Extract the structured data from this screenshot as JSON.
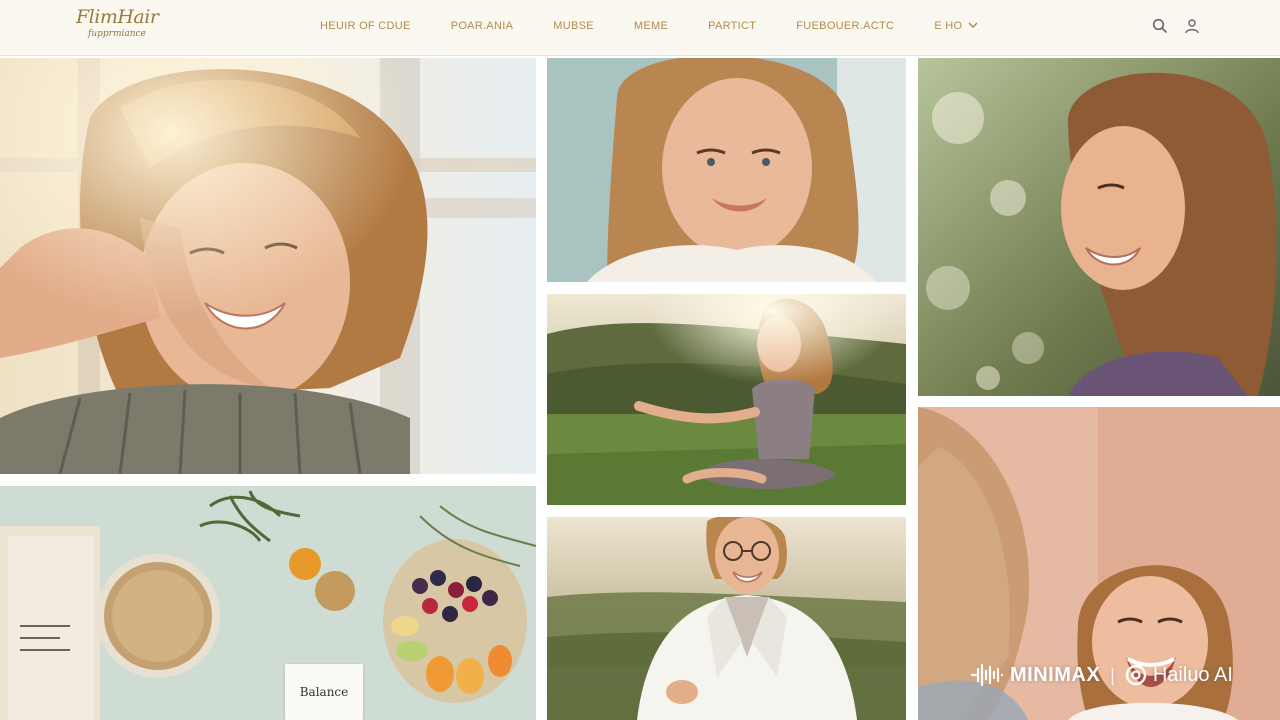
{
  "brand": {
    "logo_main": "FlimHair",
    "logo_sub": "fupprmiance"
  },
  "nav": {
    "items": [
      "HEUIR OF CDUE",
      "POAR.ANIA",
      "MUBSE",
      "MEME",
      "PARTICT",
      "FUEBOUER.ACTC",
      "E HO"
    ]
  },
  "header_icons": [
    "search-icon",
    "user-icon"
  ],
  "gallery": {
    "book_label": "Balance"
  },
  "watermark": {
    "brand_a": "MINIMAX",
    "brand_b": "Hailuo AI"
  },
  "colors": {
    "accent": "#b08c4a",
    "header_bg": "#fbf8f1"
  }
}
